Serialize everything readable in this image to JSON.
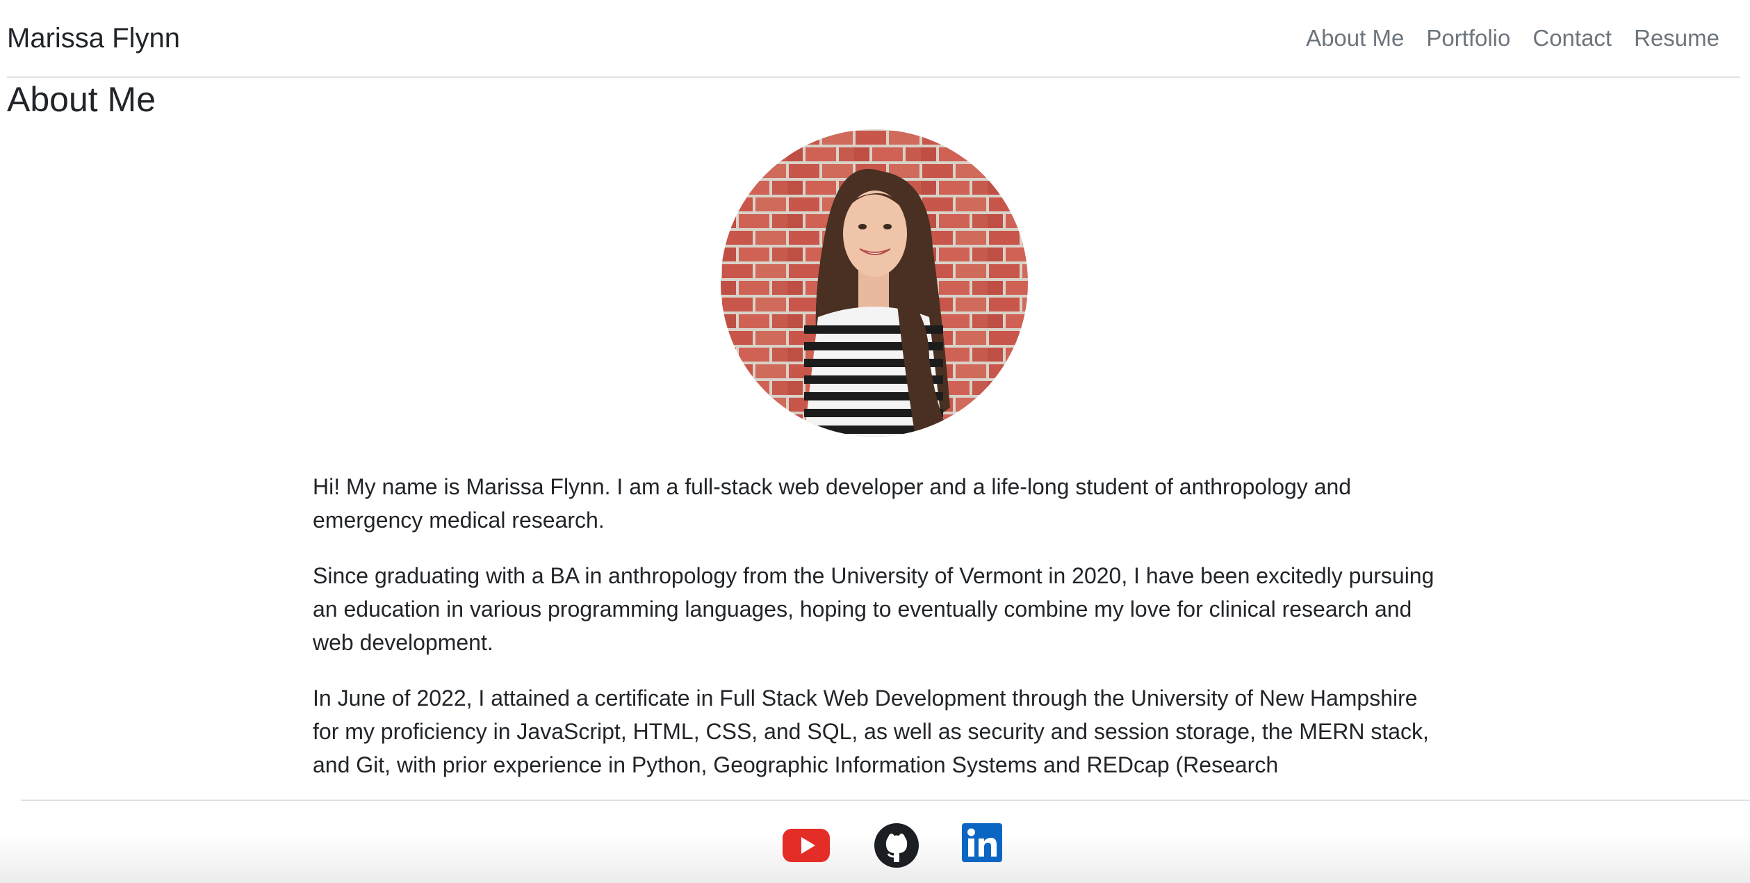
{
  "brand": "Marissa Flynn",
  "nav": {
    "items": [
      {
        "label": "About Me"
      },
      {
        "label": "Portfolio"
      },
      {
        "label": "Contact"
      },
      {
        "label": "Resume"
      }
    ]
  },
  "page": {
    "title": "About Me"
  },
  "bio": {
    "paragraphs": [
      "Hi! My name is Marissa Flynn. I am a full-stack web developer and a life-long student of anthropology and emergency medical research.",
      "Since graduating with a BA in anthropology from the University of Vermont in 2020, I have been excitedly pursuing an education in various programming languages, hoping to eventually combine my love for clinical research and web development.",
      "In June of 2022, I attained a certificate in Full Stack Web Development through the University of New Hampshire for my proficiency in JavaScript, HTML, CSS, and SQL, as well as security and session storage, the MERN stack, and Git, with prior experience in Python, Geographic Information Systems and REDcap (Research"
    ]
  },
  "footer": {
    "social": [
      {
        "icon": "youtube-icon",
        "color": "#e52d27"
      },
      {
        "icon": "github-icon",
        "color": "#1b1f23"
      },
      {
        "icon": "linkedin-icon",
        "color": "#0a66c2"
      }
    ]
  }
}
